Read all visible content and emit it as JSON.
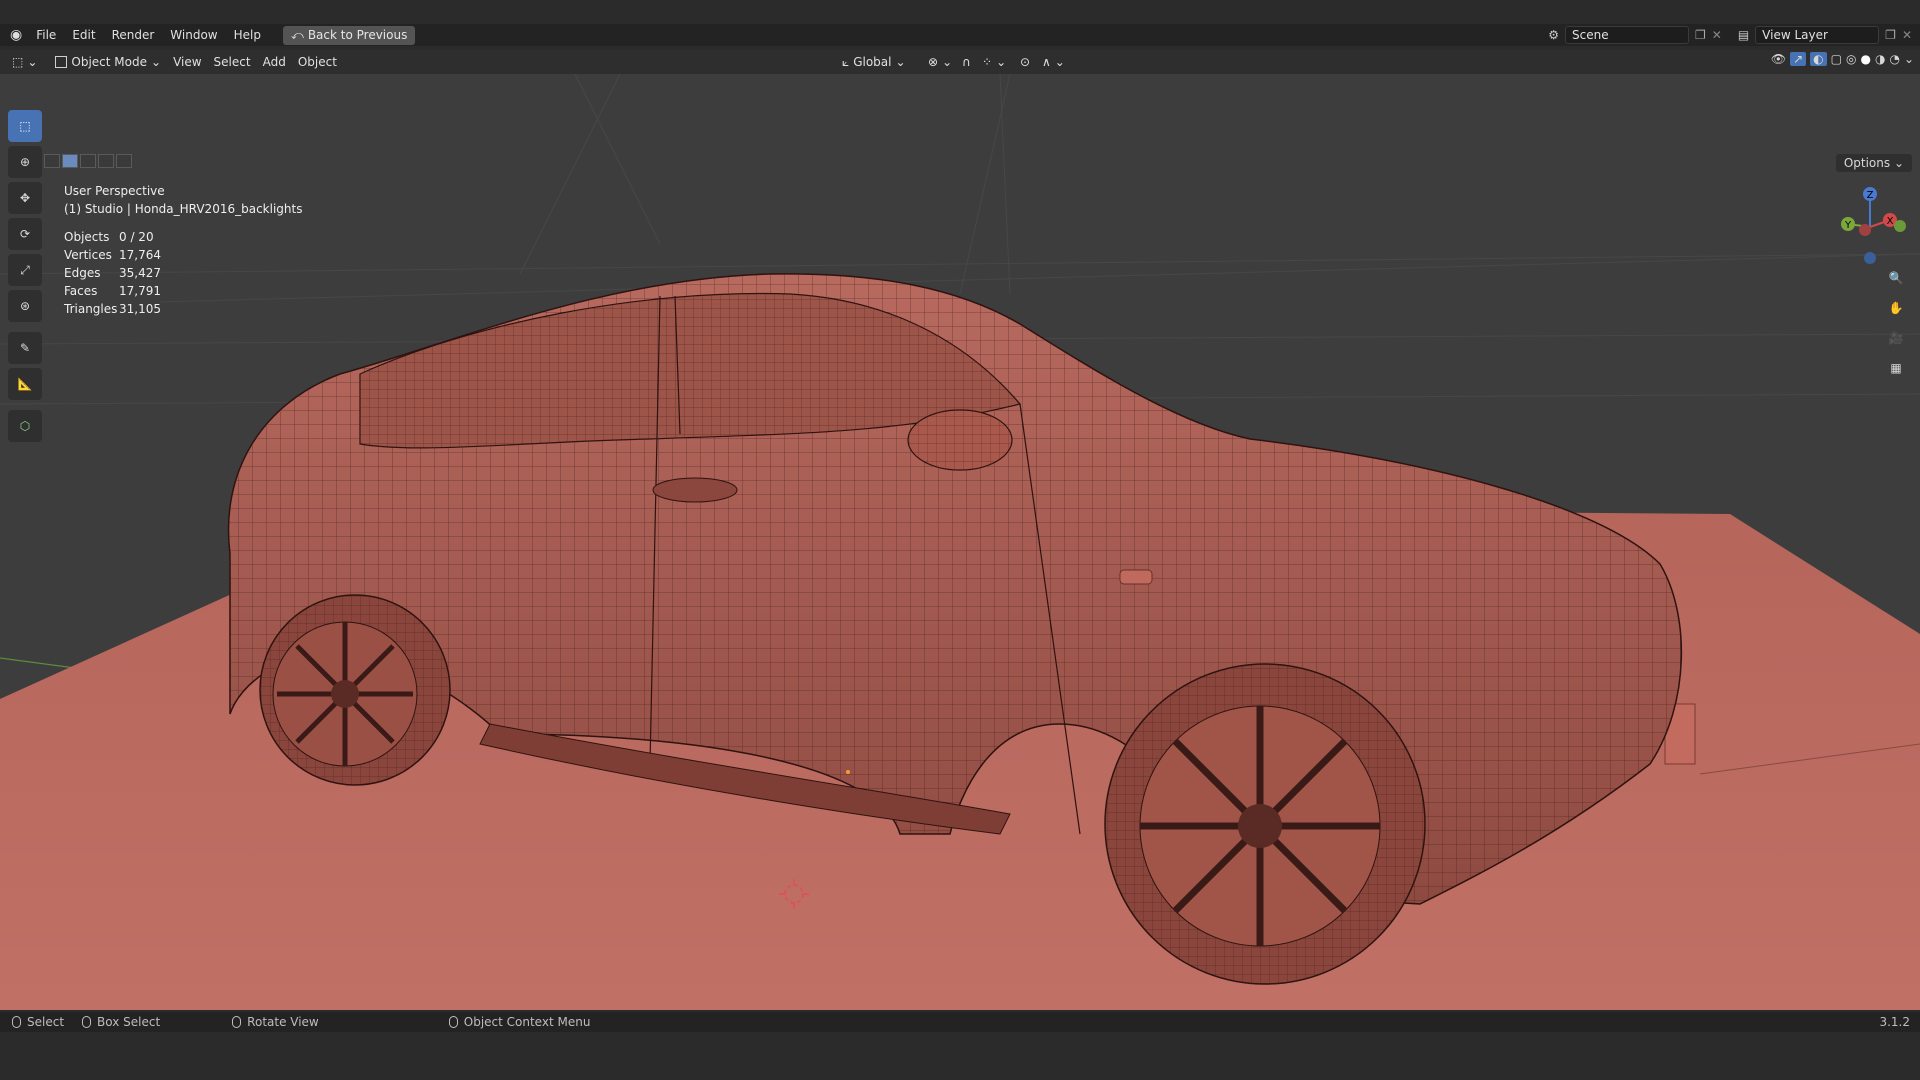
{
  "topbar": {
    "menu": [
      "File",
      "Edit",
      "Render",
      "Window",
      "Help"
    ],
    "back_label": "Back to Previous",
    "scene": "Scene",
    "view_layer": "View Layer"
  },
  "header": {
    "mode": "Object Mode",
    "menus": [
      "View",
      "Select",
      "Add",
      "Object"
    ],
    "transform_orientation": "Global"
  },
  "viewport": {
    "perspective": "User Perspective",
    "collection_object": "(1) Studio | Honda_HRV2016_backlights",
    "options_label": "Options",
    "stats": [
      {
        "label": "Objects",
        "value": "0 / 20"
      },
      {
        "label": "Vertices",
        "value": "17,764"
      },
      {
        "label": "Edges",
        "value": "35,427"
      },
      {
        "label": "Faces",
        "value": "17,791"
      },
      {
        "label": "Triangles",
        "value": "31,105"
      }
    ],
    "gizmo": {
      "x": "X",
      "y": "Y",
      "z": "Z"
    }
  },
  "statusbar": {
    "select": "Select",
    "box_select": "Box Select",
    "rotate_view": "Rotate View",
    "context_menu": "Object Context Menu",
    "version": "3.1.2"
  },
  "colors": {
    "active_tool": "#4772b3",
    "mesh": "#a3554b",
    "floor": "#b56457"
  }
}
